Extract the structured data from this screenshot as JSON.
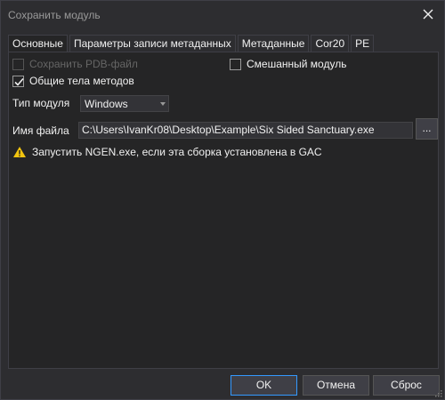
{
  "window": {
    "title": "Сохранить модуль"
  },
  "tabs": [
    {
      "label": "Основные",
      "active": true
    },
    {
      "label": "Параметры записи метаданных",
      "active": false
    },
    {
      "label": "Метаданные",
      "active": false
    },
    {
      "label": "Cor20",
      "active": false
    },
    {
      "label": "PE",
      "active": false
    }
  ],
  "general": {
    "save_pdb": {
      "label": "Сохранить PDB-файл",
      "checked": false,
      "enabled": false
    },
    "mixed_module": {
      "label": "Смешанный модуль",
      "checked": false
    },
    "shared_method_bodies": {
      "label": "Общие тела методов",
      "checked": true
    },
    "module_type": {
      "label": "Тип модуля",
      "value": "Windows"
    },
    "filename": {
      "label": "Имя файла",
      "value": "C:\\Users\\IvanKr08\\Desktop\\Example\\Six Sided Sanctuary.exe",
      "browse_label": "..."
    },
    "warning": "Запустить NGEN.exe, если эта сборка установлена в GAC"
  },
  "buttons": {
    "ok": "OK",
    "cancel": "Отмена",
    "reset": "Сброс"
  },
  "colors": {
    "background": "#2d2d30",
    "panel": "#252526",
    "accent": "#3399ff",
    "warning": "#f2c40f"
  }
}
